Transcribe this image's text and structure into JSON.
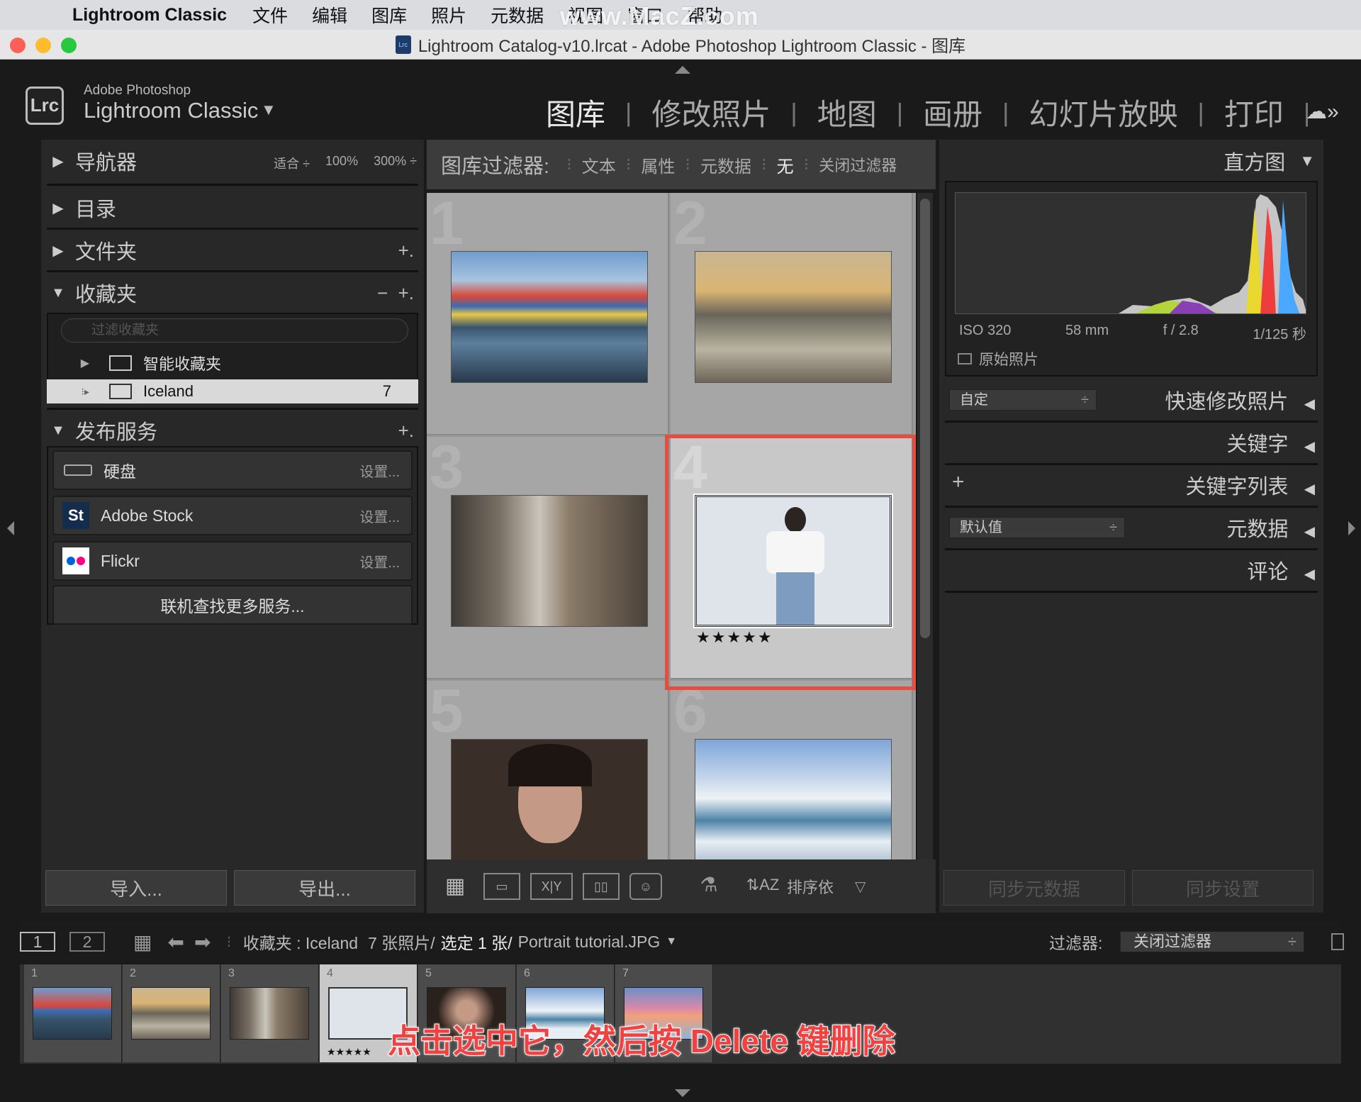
{
  "menubar": {
    "app_name": "Lightroom Classic",
    "items": [
      "文件",
      "编辑",
      "图库",
      "照片",
      "元数据",
      "视图",
      "窗口",
      "帮助"
    ]
  },
  "watermark": "www.MacZ.com",
  "window": {
    "title": "Lightroom Catalog-v10.lrcat - Adobe Photoshop Lightroom Classic - 图库",
    "doc_icon_text": "Lrc"
  },
  "identity": {
    "logo": "Lrc",
    "small": "Adobe Photoshop",
    "big": "Lightroom Classic",
    "arrow": "▼"
  },
  "modules": [
    "图库",
    "修改照片",
    "地图",
    "画册",
    "幻灯片放映",
    "打印"
  ],
  "left": {
    "navigator": {
      "title": "导航器",
      "opts": [
        "适合 ÷",
        "100%",
        "300% ÷"
      ]
    },
    "catalog": "目录",
    "folders": "文件夹",
    "collections": {
      "title": "收藏夹",
      "search_placeholder": "过滤收藏夹",
      "smart": "智能收藏夹",
      "iceland": "Iceland",
      "iceland_count": "7"
    },
    "publish": {
      "title": "发布服务",
      "services": [
        {
          "name": "硬盘",
          "set": "设置..."
        },
        {
          "name": "Adobe Stock",
          "set": "设置..."
        },
        {
          "name": "Flickr",
          "set": "设置..."
        }
      ],
      "more": "联机查找更多服务..."
    },
    "import": "导入...",
    "export": "导出..."
  },
  "filter": {
    "label": "图库过滤器:",
    "items": [
      "文本",
      "属性",
      "元数据",
      "无",
      "关闭过滤器"
    ]
  },
  "grid": {
    "cells": [
      "1",
      "2",
      "3",
      "4",
      "5",
      "6"
    ],
    "selected_stars": "★★★★★"
  },
  "toolbar": {
    "sort": "排序依"
  },
  "right": {
    "histogram": "直方图",
    "info": [
      "ISO 320",
      "58 mm",
      "f / 2.8",
      "1/125 秒"
    ],
    "original": "原始照片",
    "quick_preset": "自定",
    "quick": "快速修改照片",
    "keywords": "关键字",
    "keyword_list": "关键字列表",
    "meta_preset": "默认值",
    "metadata": "元数据",
    "comments": "评论",
    "sync_meta": "同步元数据",
    "sync_settings": "同步设置"
  },
  "strip": {
    "page1": "1",
    "page2": "2",
    "path": "收藏夹 : Iceland",
    "count": "7 张照片/",
    "selected": "选定 1 张/",
    "file": "Portrait tutorial.JPG",
    "filter_label": "过滤器:",
    "filter_value": "关闭过滤器",
    "nums": [
      "1",
      "2",
      "3",
      "4",
      "5",
      "6",
      "7"
    ],
    "stars": "★★★★★"
  },
  "caption": "点击选中它，然后按 Delete 键删除"
}
